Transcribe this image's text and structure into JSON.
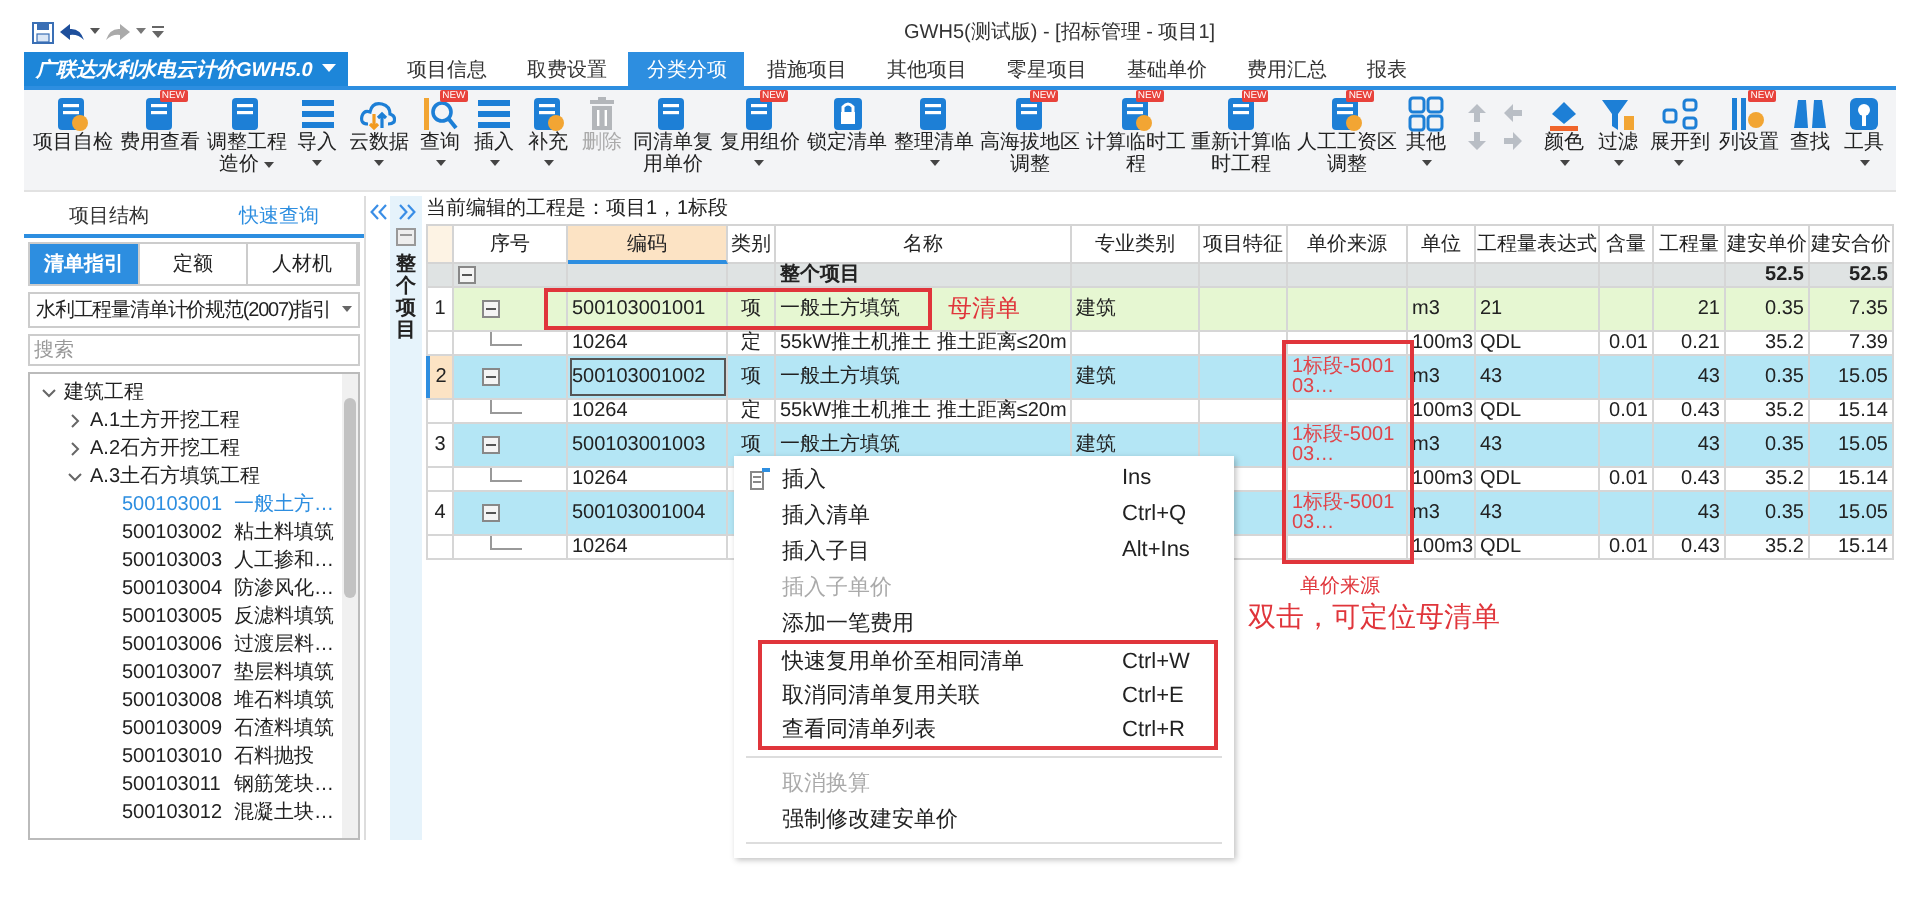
{
  "window": {
    "title": "GWH5(测试版) - [招标管理 - 项目1]"
  },
  "app_button": {
    "label": "广联达水利水电云计价GWH5.0"
  },
  "menu_tabs": [
    {
      "label": "项目信息",
      "selected": false
    },
    {
      "label": "取费设置",
      "selected": false
    },
    {
      "label": "分类分项",
      "selected": true
    },
    {
      "label": "措施项目",
      "selected": false
    },
    {
      "label": "其他项目",
      "selected": false
    },
    {
      "label": "零星项目",
      "selected": false
    },
    {
      "label": "基础单价",
      "selected": false
    },
    {
      "label": "费用汇总",
      "selected": false
    },
    {
      "label": "报表",
      "selected": false
    }
  ],
  "ribbon": [
    {
      "kind": "button",
      "lines": [
        "项目自检"
      ],
      "dropdown": false,
      "disabled": false
    },
    {
      "kind": "button",
      "lines": [
        "费用查看"
      ],
      "dropdown": false,
      "disabled": false,
      "badge": "NEW"
    },
    {
      "kind": "button",
      "lines": [
        "调整工程",
        "造价"
      ],
      "dropdown": true,
      "disabled": false
    },
    {
      "kind": "button",
      "lines": [
        "导入"
      ],
      "dropdown": true,
      "disabled": false
    },
    {
      "kind": "button",
      "lines": [
        "云数据"
      ],
      "dropdown": true,
      "disabled": false
    },
    {
      "kind": "button",
      "lines": [
        "查询"
      ],
      "dropdown": true,
      "disabled": false,
      "badge": "NEW"
    },
    {
      "kind": "button",
      "lines": [
        "插入"
      ],
      "dropdown": true,
      "disabled": false
    },
    {
      "kind": "button",
      "lines": [
        "补充"
      ],
      "dropdown": true,
      "disabled": false
    },
    {
      "kind": "button",
      "lines": [
        "删除"
      ],
      "dropdown": false,
      "disabled": true
    },
    {
      "kind": "button",
      "lines": [
        "同清单复",
        "用单价"
      ],
      "dropdown": false,
      "disabled": false
    },
    {
      "kind": "button",
      "lines": [
        "复用组价"
      ],
      "dropdown": true,
      "disabled": false,
      "badge": "NEW"
    },
    {
      "kind": "button",
      "lines": [
        "锁定清单"
      ],
      "dropdown": false,
      "disabled": false
    },
    {
      "kind": "button",
      "lines": [
        "整理清单"
      ],
      "dropdown": true,
      "disabled": false
    },
    {
      "kind": "button",
      "lines": [
        "高海拔地区",
        "调整"
      ],
      "dropdown": false,
      "disabled": false,
      "badge": "NEW"
    },
    {
      "kind": "button",
      "lines": [
        "计算临时工",
        "程"
      ],
      "dropdown": false,
      "disabled": false,
      "badge": "NEW"
    },
    {
      "kind": "button",
      "lines": [
        "重新计算临",
        "时工程"
      ],
      "dropdown": false,
      "disabled": false,
      "badge": "NEW"
    },
    {
      "kind": "button",
      "lines": [
        "人工工资区",
        "调整"
      ],
      "dropdown": false,
      "disabled": false,
      "badge": "NEW"
    },
    {
      "kind": "button",
      "lines": [
        "其他"
      ],
      "dropdown": true,
      "disabled": false
    },
    {
      "kind": "arrows"
    },
    {
      "kind": "button",
      "lines": [
        "颜色"
      ],
      "dropdown": true,
      "disabled": false
    },
    {
      "kind": "button",
      "lines": [
        "过滤"
      ],
      "dropdown": true,
      "disabled": false
    },
    {
      "kind": "button",
      "lines": [
        "展开到"
      ],
      "dropdown": true,
      "disabled": false
    },
    {
      "kind": "button",
      "lines": [
        "列设置"
      ],
      "dropdown": false,
      "disabled": false,
      "badge": "NEW"
    },
    {
      "kind": "button",
      "lines": [
        "查找"
      ],
      "dropdown": false,
      "disabled": false
    },
    {
      "kind": "button",
      "lines": [
        "工具"
      ],
      "dropdown": true,
      "disabled": false
    }
  ],
  "side_panel": {
    "tabs": [
      {
        "label": "项目结构",
        "selected": false
      },
      {
        "label": "快速查询",
        "selected": true
      }
    ],
    "sub_tabs": [
      {
        "label": "清单指引",
        "selected": true
      },
      {
        "label": "定额",
        "selected": false
      },
      {
        "label": "人材机",
        "selected": false
      }
    ],
    "dropdown": {
      "value": "水利工程量清单计价规范(2007)指引"
    },
    "search": {
      "placeholder": "搜索"
    },
    "tree": [
      {
        "label": "建筑工程",
        "expanded": true,
        "children": [
          {
            "label": "A.1土方开挖工程",
            "expanded": false
          },
          {
            "label": "A.2石方开挖工程",
            "expanded": false
          },
          {
            "label": "A.3土石方填筑工程",
            "expanded": true,
            "children": [
              {
                "code": "500103001",
                "label": "一般土方…",
                "selected": true
              },
              {
                "code": "500103002",
                "label": "粘土料填筑",
                "selected": false
              },
              {
                "code": "500103003",
                "label": "人工掺和…",
                "selected": false
              },
              {
                "code": "500103004",
                "label": "防渗风化…",
                "selected": false
              },
              {
                "code": "500103005",
                "label": "反滤料填筑",
                "selected": false
              },
              {
                "code": "500103006",
                "label": "过渡层料…",
                "selected": false
              },
              {
                "code": "500103007",
                "label": "垫层料填筑",
                "selected": false
              },
              {
                "code": "500103008",
                "label": "堆石料填筑",
                "selected": false
              },
              {
                "code": "500103009",
                "label": "石渣料填筑",
                "selected": false
              },
              {
                "code": "500103010",
                "label": "石料抛投",
                "selected": false
              },
              {
                "code": "500103011",
                "label": "钢筋笼块…",
                "selected": false
              },
              {
                "code": "500103012",
                "label": "混凝土块…",
                "selected": false
              }
            ]
          }
        ]
      }
    ]
  },
  "scope_strip": {
    "label": "整个项目"
  },
  "info_line": "当前编辑的工程是：项目1，1标段",
  "table": {
    "columns": [
      {
        "label": "序号",
        "selected": false
      },
      {
        "label": "编码",
        "selected": true
      },
      {
        "label": "类别",
        "selected": false
      },
      {
        "label": "名称",
        "selected": false
      },
      {
        "label": "专业类别",
        "selected": false
      },
      {
        "label": "项目特征",
        "selected": false
      },
      {
        "label": "单价来源",
        "selected": false
      },
      {
        "label": "单位",
        "selected": false
      },
      {
        "label": "工程量表达式",
        "selected": false
      },
      {
        "label": "含量",
        "selected": false
      },
      {
        "label": "工程量",
        "selected": false
      },
      {
        "label": "建安单价",
        "selected": false
      },
      {
        "label": "建安合价",
        "selected": false
      }
    ],
    "rows": [
      {
        "kind": "total",
        "name": "整个项目",
        "price": "52.5",
        "total": "52.5"
      },
      {
        "kind": "list",
        "num": "1",
        "selected": false,
        "color": "#e6f7d2",
        "code": "500103001001",
        "type": "项",
        "name": "一般土方填筑",
        "major": "建筑",
        "unit": "m3",
        "expr": "21",
        "qty": "21",
        "price": "0.35",
        "total": "7.35"
      },
      {
        "kind": "quota",
        "code": "10264",
        "type": "定",
        "name": "55kW推土机推土 推土距离≤20m",
        "unit": "100m3",
        "expr": "QDL",
        "content": "0.01",
        "qty": "0.21",
        "price": "35.2",
        "total": "7.39"
      },
      {
        "kind": "list",
        "num": "2",
        "selected": true,
        "color": "#b4e6f5",
        "code": "500103001002",
        "type": "项",
        "name": "一般土方填筑",
        "major": "建筑",
        "source": "1标段-500103…",
        "unit": "m3",
        "expr": "43",
        "qty": "43",
        "price": "0.35",
        "total": "15.05"
      },
      {
        "kind": "quota",
        "code": "10264",
        "type": "定",
        "name": "55kW推土机推土 推土距离≤20m",
        "unit": "100m3",
        "expr": "QDL",
        "content": "0.01",
        "qty": "0.43",
        "price": "35.2",
        "total": "15.14"
      },
      {
        "kind": "list",
        "num": "3",
        "selected": false,
        "color": "#b4e6f5",
        "code": "500103001003",
        "type": "项",
        "name": "一般土方填筑",
        "major": "建筑",
        "source": "1标段-500103…",
        "unit": "m3",
        "expr": "43",
        "qty": "43",
        "price": "0.35",
        "total": "15.05"
      },
      {
        "kind": "quota",
        "code": "10264",
        "unit": "100m3",
        "expr": "QDL",
        "content": "0.01",
        "qty": "0.43",
        "price": "35.2",
        "total": "15.14"
      },
      {
        "kind": "list",
        "num": "4",
        "selected": false,
        "color": "#b4e6f5",
        "code": "500103001004",
        "source": "1标段-500103…",
        "unit": "m3",
        "expr": "43",
        "qty": "43",
        "price": "0.35",
        "total": "15.05"
      },
      {
        "kind": "quota",
        "code": "10264",
        "unit": "100m3",
        "expr": "QDL",
        "content": "0.01",
        "qty": "0.43",
        "price": "35.2",
        "total": "15.14"
      }
    ]
  },
  "context_menu": {
    "sections": [
      {
        "boxed": false,
        "separator_before": false,
        "items": [
          {
            "label": "插入",
            "shortcut": "Ins",
            "disabled": false
          },
          {
            "label": "插入清单",
            "shortcut": "Ctrl+Q",
            "disabled": false
          },
          {
            "label": "插入子目",
            "shortcut": "Alt+Ins",
            "disabled": false
          },
          {
            "label": "插入子单价",
            "disabled": true
          },
          {
            "label": "添加一笔费用",
            "disabled": false
          }
        ]
      },
      {
        "boxed": true,
        "separator_before": false,
        "items": [
          {
            "label": "快速复用单价至相同清单",
            "shortcut": "Ctrl+W",
            "disabled": false
          },
          {
            "label": "取消同清单复用关联",
            "shortcut": "Ctrl+E",
            "disabled": false
          },
          {
            "label": "查看同清单列表",
            "shortcut": "Ctrl+R",
            "disabled": false
          }
        ]
      },
      {
        "boxed": false,
        "separator_before": true,
        "items": [
          {
            "label": "取消换算",
            "disabled": true
          },
          {
            "label": "强制修改建安单价",
            "disabled": false
          }
        ]
      }
    ]
  },
  "callouts": {
    "parent_label": "母清单",
    "source_label": "单价来源",
    "source_hint": "双击，可定位母清单"
  }
}
